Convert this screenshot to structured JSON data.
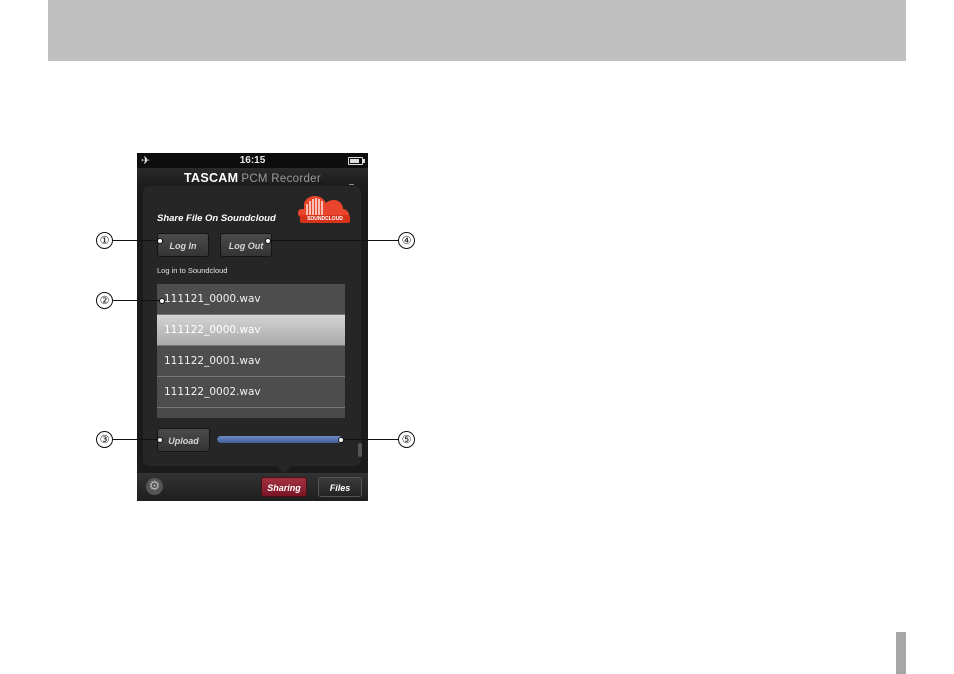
{
  "status_bar": {
    "time": "16:15",
    "airplane_icon": "airplane-icon",
    "battery_icon": "battery-icon"
  },
  "app_header": {
    "brand": "TASCAM",
    "product": "PCM Recorder"
  },
  "share": {
    "title": "Share File On Soundcloud",
    "logo_text": "SOUNDCLOUD",
    "login_label": "Log In",
    "logout_label": "Log Out",
    "status_text": "Log in to Soundcloud"
  },
  "files": [
    {
      "name": "111121_0000.wav",
      "selected": false
    },
    {
      "name": "111122_0000.wav",
      "selected": true
    },
    {
      "name": "111122_0001.wav",
      "selected": false
    },
    {
      "name": "111122_0002.wav",
      "selected": false
    }
  ],
  "upload": {
    "label": "Upload",
    "progress": 1.0
  },
  "tabbar": {
    "settings_icon": "gear-icon",
    "sharing_label": "Sharing",
    "files_label": "Files"
  },
  "callouts": [
    "①",
    "②",
    "③",
    "④",
    "⑤"
  ],
  "colors": {
    "accent_sharing": "#8e2232",
    "progress": "#4f6fac",
    "soundcloud": "#e8452c"
  }
}
